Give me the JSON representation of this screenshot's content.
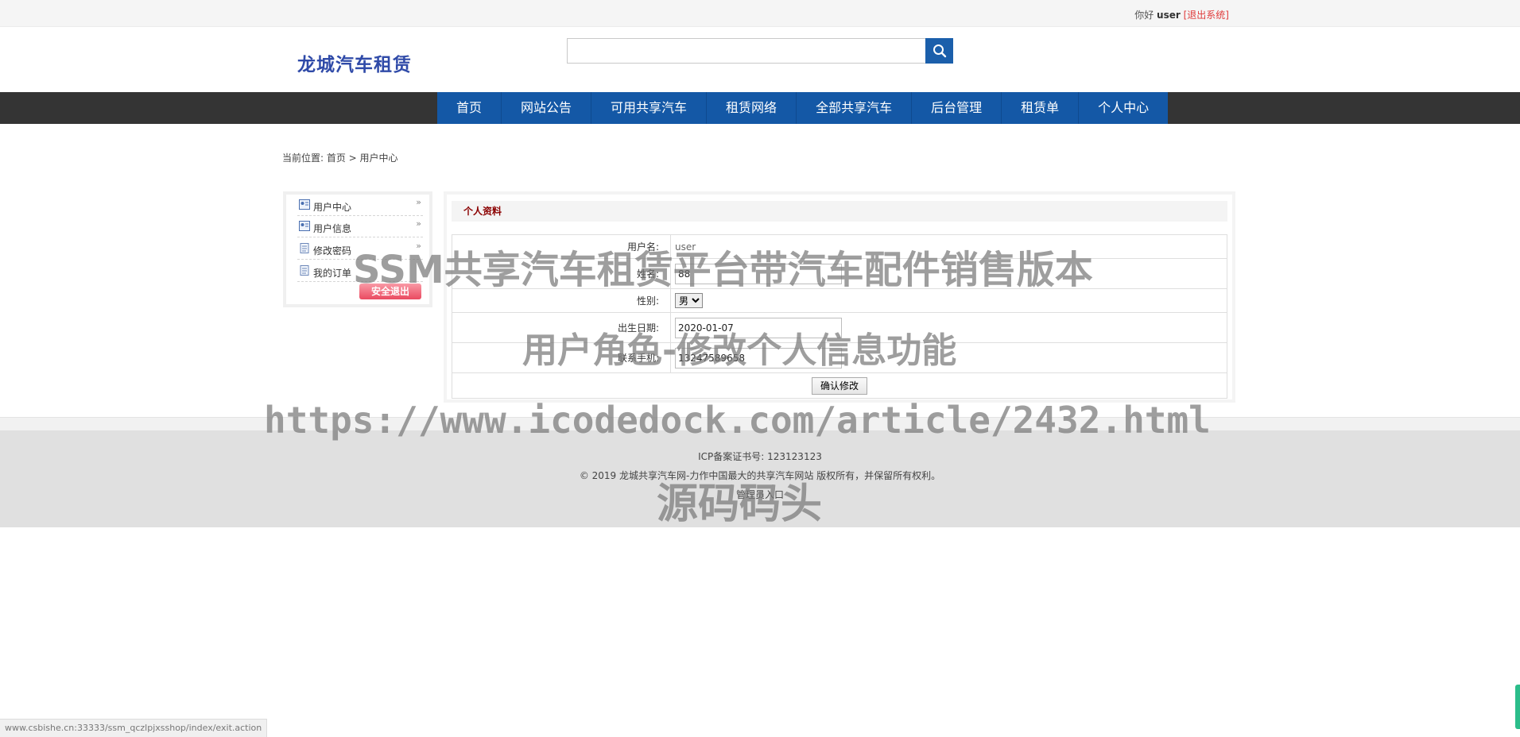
{
  "topbar": {
    "greeting": "你好",
    "username": "user",
    "logout": "[退出系统]"
  },
  "header": {
    "logo": "龙城汽车租赁",
    "search": {
      "placeholder": "",
      "value": ""
    }
  },
  "nav": {
    "items": [
      "首页",
      "网站公告",
      "可用共享汽车",
      "租赁网络",
      "全部共享汽车",
      "后台管理",
      "租赁单",
      "个人中心"
    ]
  },
  "breadcrumb": {
    "text": "当前位置: 首页 > 用户中心"
  },
  "sidebar": {
    "items": [
      "用户中心",
      "用户信息",
      "修改密码",
      "我的订单"
    ],
    "safe_exit": "安全退出"
  },
  "profile": {
    "title": "个人资料",
    "username_label": "用户名:",
    "username_value": "user",
    "name_label": "姓名:",
    "name_value": "88",
    "gender_label": "性别:",
    "gender_value": "男",
    "birth_label": "出生日期:",
    "birth_value": "2020-01-07",
    "phone_label": "联系手机:",
    "phone_value": "13247589658",
    "submit": "确认修改"
  },
  "footer": {
    "icp": "ICP备案证书号: 123123123",
    "copyright": "© 2019 龙城共享汽车网-力作中国最大的共享汽车网站 版权所有，并保留所有权利。",
    "admin_entry": "管理员入口"
  },
  "watermarks": {
    "line1": "SSM共享汽车租赁平台带汽车配件销售版本",
    "line2": "用户角色-修改个人信息功能",
    "line3": "https://www.icodedock.com/article/2432.html",
    "line4": "源码码头"
  },
  "status_bar": {
    "url": "www.csbishe.cn:33333/ssm_qczlpjxsshop/index/exit.action"
  },
  "colors": {
    "nav_blue": "#1458a6",
    "navbar_dark": "#343434",
    "logo_blue": "#2f4aa8",
    "title_red": "#8b0000",
    "logout_red": "#e03b3b"
  }
}
